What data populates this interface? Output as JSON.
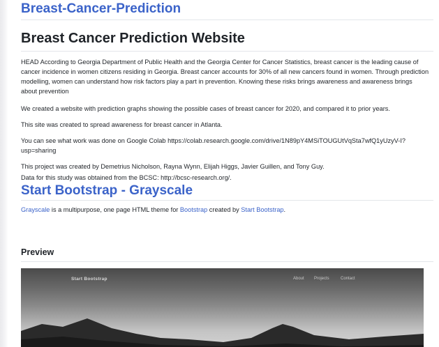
{
  "repo": {
    "title": "Breast-Cancer-Prediction"
  },
  "readme": {
    "heading": "Breast Cancer Prediction Website",
    "paragraphs": [
      "HEAD According to Georgia Department of Public Health and the Georgia Center for Cancer Statistics, breast cancer is the leading cause of cancer incidence in women citizens residing in Georgia. Breast cancer accounts for 30% of all new cancers found in women. Through prediction modelling, women can understand how risk factors play a part in prevention. Knowing these risks brings awareness and awareness brings about prevention",
      "We created a website with prediction graphs showing the possible cases of breast cancer for 2020, and compared it to prior years.",
      "This site was created to spread awareness for breast cancer in Atlanta.",
      "You can see what work was done on Google Colab https://colab.research.google.com/drive/1N89pY4MSiTOUGUtVqSta7wfQ1yUzyV-I?usp=sharing",
      "This project was created by Demetrius Nicholson, Rayna Wynn, Elijah Higgs, Javier Guillen, and Tony Guy.",
      "Data for this study was obtained from the BCSC: http://bcsc-research.org/."
    ],
    "section_heading": "Start Bootstrap - Grayscale",
    "desc": {
      "link1": "Grayscale",
      "text1": " is a multipurpose, one page HTML theme for ",
      "link2": "Bootstrap",
      "text2": " created by ",
      "link3": "Start Bootstrap",
      "text3": "."
    },
    "preview_heading": "Preview",
    "preview": {
      "brand": "Start Bootstrap",
      "nav": [
        "About",
        "Projects",
        "Contact"
      ]
    }
  }
}
